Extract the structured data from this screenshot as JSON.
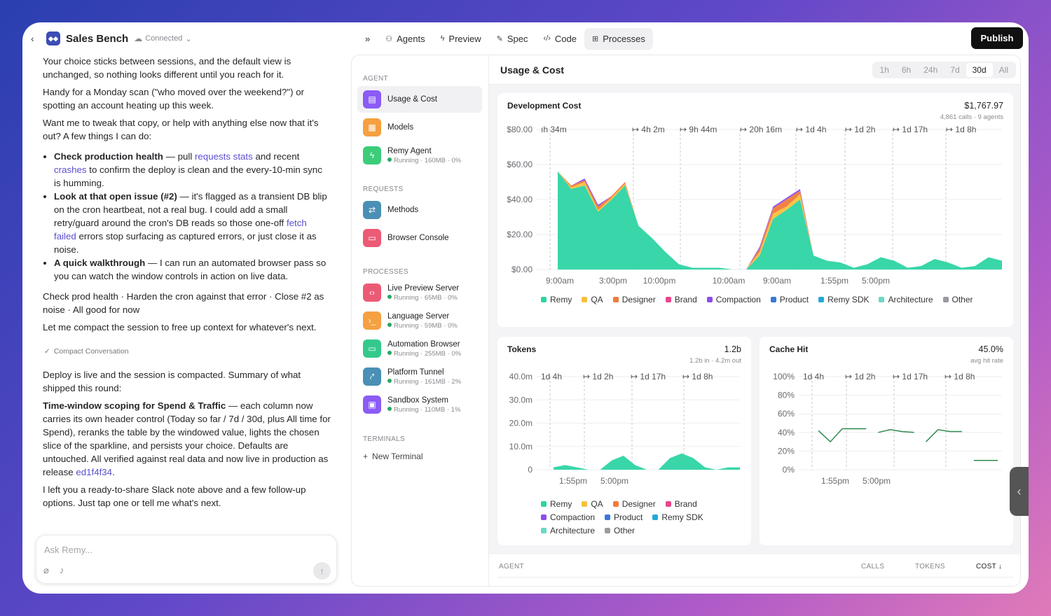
{
  "header": {
    "title": "Sales Bench",
    "status": "Connected"
  },
  "chat": {
    "p1": "Your choice sticks between sessions, and the default view is unchanged, so nothing looks different until you reach for it.",
    "p2": "Handy for a Monday scan (\"who moved over the weekend?\") or spotting an account heating up this week.",
    "p3": "Want me to tweak that copy, or help with anything else now that it's out? A few things I can do:",
    "b1_strong": "Check production health",
    "b1_a": " — pull ",
    "b1_link1": "requests stats",
    "b1_b": " and recent ",
    "b1_link2": "crashes",
    "b1_c": " to confirm the deploy is clean and the every-10-min sync is humming.",
    "b2_strong": "Look at that open issue (#2)",
    "b2_a": " — it's flagged as a transient DB blip on the cron heartbeat, not a real bug. I could add a small retry/guard around the cron's DB reads so those one-off ",
    "b2_link": "fetch failed",
    "b2_b": " errors stop surfacing as captured errors, or just close it as noise.",
    "b3_strong": "A quick walkthrough",
    "b3_a": " — I can run an automated browser pass so you can watch the window controls in action on live data.",
    "p4": "Check prod health · Harden the cron against that error · Close #2 as noise · All good for now",
    "p5": "Let me compact the session to free up context for whatever's next.",
    "compact_label": "Compact Conversation",
    "p6": "Deploy is live and the session is compacted. Summary of what shipped this round:",
    "p7_strong": "Time-window scoping for Spend & Traffic",
    "p7_a": " — each column now carries its own header control (Today so far / 7d / 30d, plus All time for Spend), reranks the table by the windowed value, lights the chosen slice of the sparkline, and persists your choice. Defaults are untouched. All verified against real data and now live in production as release ",
    "p7_link": "ed1f4f34",
    "p7_b": ".",
    "p8": "I left you a ready-to-share Slack note above and a few follow-up options. Just tap one or tell me what's next.",
    "input_placeholder": "Ask Remy..."
  },
  "tabs": [
    {
      "label": "Agents",
      "icon": "agents-icon"
    },
    {
      "label": "Preview",
      "icon": "bolt-icon"
    },
    {
      "label": "Spec",
      "icon": "edit-icon"
    },
    {
      "label": "Code",
      "icon": "code-icon"
    },
    {
      "label": "Processes",
      "icon": "processes-icon"
    }
  ],
  "publish_label": "Publish",
  "sidebar": {
    "agent_section": "AGENT",
    "requests_section": "REQUESTS",
    "processes_section": "PROCESSES",
    "terminals_section": "TERMINALS",
    "new_terminal": "New Terminal",
    "agent_items": [
      {
        "label": "Usage & Cost",
        "color": "#8b5cf6",
        "icon": "receipt-icon"
      },
      {
        "label": "Models",
        "color": "#f5a041",
        "icon": "models-icon"
      },
      {
        "label": "Remy Agent",
        "sub": "Running · 160MB · 0%",
        "color": "#3ccc7a",
        "icon": "bolt-icon"
      }
    ],
    "request_items": [
      {
        "label": "Methods",
        "color": "#4a8fb5",
        "icon": "swap-icon"
      },
      {
        "label": "Browser Console",
        "color": "#ec5b76",
        "icon": "window-icon"
      }
    ],
    "process_items": [
      {
        "label": "Live Preview Server",
        "sub": "Running · 65MB · 0%",
        "color": "#ec5b76",
        "icon": "code-icon"
      },
      {
        "label": "Language Server",
        "sub": "Running · 59MB · 0%",
        "color": "#f5a041",
        "icon": "terminal-icon"
      },
      {
        "label": "Automation Browser",
        "sub": "Running · 255MB · 0%",
        "color": "#34c98c",
        "icon": "monitor-icon"
      },
      {
        "label": "Platform Tunnel",
        "sub": "Running · 161MB · 2%",
        "color": "#4a8fb5",
        "icon": "link-icon"
      },
      {
        "label": "Sandbox System",
        "sub": "Running · 110MB · 1%",
        "color": "#8b5cf6",
        "icon": "box-icon"
      }
    ]
  },
  "main": {
    "title": "Usage & Cost",
    "ranges": [
      "1h",
      "6h",
      "24h",
      "7d",
      "30d",
      "All"
    ],
    "active_range": "30d"
  },
  "legend_colors": {
    "Remy": "#2dd4a3",
    "QA": "#f5c13d",
    "Designer": "#f27a3a",
    "Brand": "#e8478a",
    "Compaction": "#8b4ee8",
    "Product": "#3a78d8",
    "Remy SDK": "#24a8d8",
    "Architecture": "#6ad8c4",
    "Other": "#9a9aa0"
  },
  "dev_cost": {
    "title": "Development Cost",
    "value": "$1,767.97",
    "sub": "4,861 calls · 9 agents",
    "legend": [
      "Remy",
      "QA",
      "Designer",
      "Brand",
      "Compaction",
      "Product",
      "Remy SDK",
      "Architecture",
      "Other"
    ]
  },
  "tokens": {
    "title": "Tokens",
    "value": "1.2b",
    "sub": "1.2b in · 4.2m out",
    "legend": [
      "Remy",
      "QA",
      "Designer",
      "Brand",
      "Compaction",
      "Product",
      "Remy SDK",
      "Architecture",
      "Other"
    ]
  },
  "cache": {
    "title": "Cache Hit",
    "value": "45.0%",
    "sub": "avg hit rate"
  },
  "table": {
    "columns": [
      "AGENT",
      "CALLS",
      "TOKENS",
      "COST ↓"
    ]
  },
  "chart_data": [
    {
      "type": "area",
      "title": "Development Cost",
      "y_ticks": [
        "$80.00",
        "$60.00",
        "$40.00",
        "$20.00",
        "$0.00"
      ],
      "ylim": [
        0,
        80
      ],
      "x_ticks": [
        "9:00am",
        "3:00pm",
        "10:00pm",
        "10:00am",
        "9:00am",
        "1:55pm",
        "5:00pm"
      ],
      "gap_labels": [
        "ıh 34m",
        "↦ 4h 2m",
        "↦ 9h 44m",
        "↦ 20h 16m",
        "↦ 1d 4h",
        "↦ 1d 2h",
        "↦ 1d 17h",
        "↦ 1d 8h"
      ],
      "series": [
        {
          "name": "Remy",
          "values": [
            56,
            46,
            48,
            33,
            40,
            48,
            25,
            18,
            10,
            3,
            1,
            1,
            1,
            0,
            0,
            8,
            29,
            34,
            40,
            8,
            5,
            4,
            1,
            3,
            7,
            5,
            1,
            2,
            6,
            4,
            1,
            2,
            7,
            5
          ]
        },
        {
          "name": "QA",
          "values": [
            0,
            1,
            2,
            1,
            1,
            1,
            0,
            0,
            0,
            0,
            0,
            0,
            0,
            0,
            0,
            2,
            3,
            2,
            3,
            0,
            0,
            0,
            0,
            0,
            0,
            0,
            0,
            0,
            0,
            0,
            0,
            0,
            0,
            0
          ]
        },
        {
          "name": "Designer",
          "values": [
            0,
            1,
            1,
            2,
            1,
            1,
            0,
            0,
            0,
            0,
            0,
            0,
            0,
            0,
            0,
            2,
            3,
            4,
            2,
            0,
            0,
            0,
            0,
            0,
            0,
            0,
            0,
            0,
            0,
            0,
            0,
            0,
            0,
            0
          ]
        },
        {
          "name": "Compaction",
          "values": [
            0,
            0,
            1,
            1,
            0,
            0,
            0,
            0,
            0,
            0,
            0,
            0,
            0,
            0,
            0,
            1,
            1,
            1,
            1,
            0,
            0,
            0,
            0,
            0,
            0,
            0,
            0,
            0,
            0,
            0,
            0,
            0,
            0,
            0
          ]
        }
      ]
    },
    {
      "type": "area",
      "title": "Tokens",
      "y_ticks": [
        "40.0m",
        "30.0m",
        "20.0m",
        "10.0m",
        "0"
      ],
      "ylim": [
        0,
        40
      ],
      "x_ticks": [
        "1:55pm",
        "5:00pm"
      ],
      "gap_labels": [
        "1d 4h",
        "↦ 1d 2h",
        "↦ 1d 17h",
        "↦ 1d 8h"
      ],
      "series": [
        {
          "name": "Remy",
          "values": [
            1,
            2,
            1,
            0,
            0,
            4,
            6,
            2,
            0,
            0,
            5,
            7,
            5,
            1,
            0,
            1,
            1
          ]
        }
      ]
    },
    {
      "type": "line",
      "title": "Cache Hit",
      "y_ticks": [
        "100%",
        "80%",
        "60%",
        "40%",
        "20%",
        "0%"
      ],
      "ylim": [
        0,
        100
      ],
      "x_ticks": [
        "1:55pm",
        "5:00pm"
      ],
      "gap_labels": [
        "1d 4h",
        "↦ 1d 2h",
        "↦ 1d 17h",
        "↦ 1d 8h"
      ],
      "series": [
        {
          "name": "Cache Hit",
          "values": [
            42,
            30,
            44,
            44,
            44,
            40,
            43,
            41,
            40,
            30,
            43,
            41,
            41,
            10,
            10,
            10
          ]
        }
      ]
    }
  ]
}
